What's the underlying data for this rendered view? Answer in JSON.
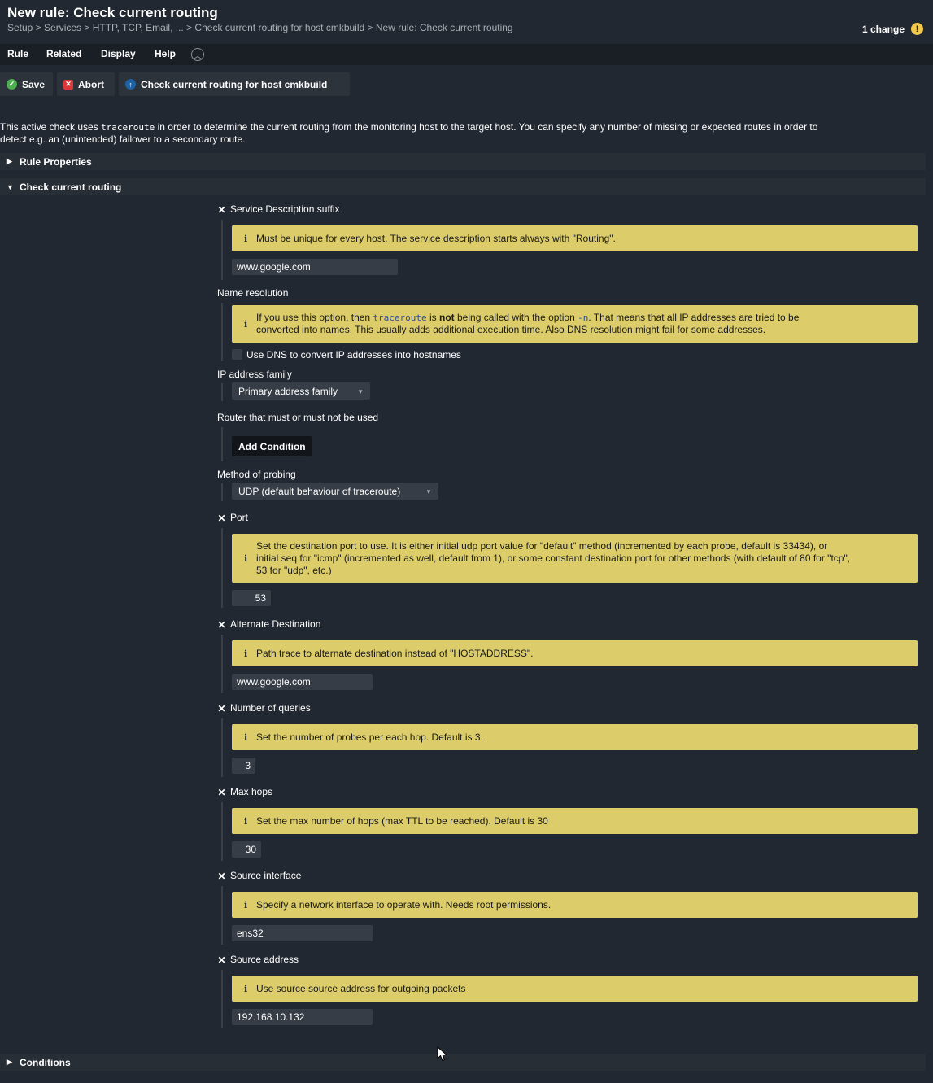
{
  "header": {
    "title": "New rule: Check current routing",
    "breadcrumb": "Setup > Services > HTTP, TCP, Email, ... > Check current routing for host cmkbuild > New rule: Check current routing",
    "changes_label": "1 change",
    "changes_icon": "warning-icon"
  },
  "menu": {
    "items": [
      "Rule",
      "Related",
      "Display",
      "Help"
    ]
  },
  "toolbar": {
    "save_label": "Save",
    "abort_label": "Abort",
    "check_label": "Check current routing for host cmkbuild"
  },
  "intro": {
    "before": "This active check uses ",
    "code": "traceroute",
    "after_line1": " in order to determine the current routing from the monitoring host to the target host. You can specify any number of missing or expected routes in order to",
    "line2": "detect e.g. an (unintended) failover to a secondary route."
  },
  "sections": {
    "rule_properties": "Rule Properties",
    "check_current_routing": "Check current routing",
    "conditions": "Conditions"
  },
  "form": {
    "service_suffix": {
      "label": "Service Description suffix",
      "help": "Must be unique for every host. The service description starts always with \"Routing\".",
      "value": "www.google.com"
    },
    "name_resolution": {
      "label": "Name resolution",
      "help_a": "If you use this option, then ",
      "help_code": "traceroute",
      "help_b": " is ",
      "help_bold": "not",
      "help_c": " being called with the option ",
      "help_code2": "-n",
      "help_d": ". That means that all IP addresses are tried to be",
      "help_line2": "converted into names. This usually adds additional execution time. Also DNS resolution might fail for some addresses.",
      "checkbox_label": "Use DNS to convert IP addresses into hostnames",
      "checked": false
    },
    "ip_family": {
      "label": "IP address family",
      "selected": "Primary address family"
    },
    "router": {
      "label": "Router that must or must not be used",
      "button": "Add Condition"
    },
    "probing": {
      "label": "Method of probing",
      "selected": "UDP (default behaviour of traceroute)"
    },
    "port": {
      "label": "Port",
      "help_line1": "Set the destination port to use. It is either initial udp port value for \"default\" method (incremented by each probe, default is 33434), or",
      "help_line2": "initial seq for \"icmp\" (incremented as well, default from 1), or some constant destination port for other methods (with default of 80 for \"tcp\",",
      "help_line3": "53 for \"udp\", etc.)",
      "value": "53"
    },
    "alt_dest": {
      "label": "Alternate Destination",
      "help": "Path trace to alternate destination instead of \"HOSTADDRESS\".",
      "value": "www.google.com"
    },
    "queries": {
      "label": "Number of queries",
      "help": "Set the number of probes per each hop. Default is 3.",
      "value": "3"
    },
    "max_hops": {
      "label": "Max hops",
      "help": "Set the max number of hops (max TTL to be reached). Default is 30",
      "value": "30"
    },
    "source_iface": {
      "label": "Source interface",
      "help": "Specify a network interface to operate with. Needs root permissions.",
      "value": "ens32"
    },
    "source_addr": {
      "label": "Source address",
      "help": "Use source source address for outgoing packets",
      "value": "192.168.10.132"
    }
  },
  "colors": {
    "background": "#222831",
    "help_box": "#dccd6a",
    "input_bg": "#363d46",
    "accent_ok": "#4caf50",
    "accent_abort": "#d9383a"
  }
}
